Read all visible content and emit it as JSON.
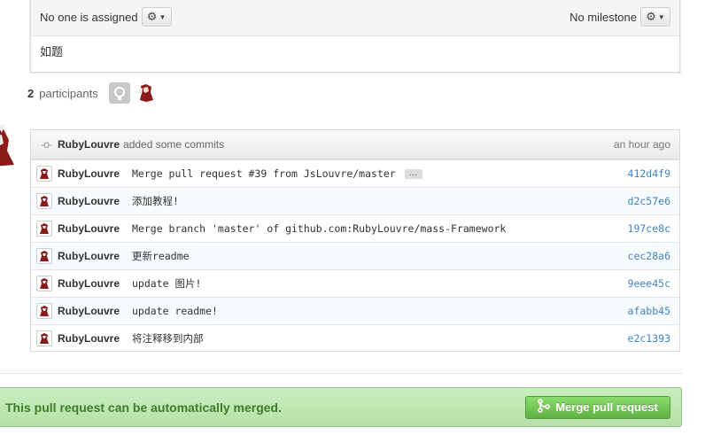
{
  "issue": {
    "assignee_text": "No one is assigned",
    "milestone_text": "No milestone",
    "body": "如题"
  },
  "participants": {
    "count": "2",
    "label": "participants"
  },
  "commits": {
    "author": "RubyLouvre",
    "action": "added some commits",
    "time": "an hour ago",
    "ellipsis": "…",
    "rows": [
      {
        "author": "RubyLouvre",
        "message": "Merge pull request #39 from JsLouvre/master",
        "sha": "412d4f9"
      },
      {
        "author": "RubyLouvre",
        "message": "添加教程!",
        "sha": "d2c57e6"
      },
      {
        "author": "RubyLouvre",
        "message": "Merge branch 'master' of github.com:RubyLouvre/mass-Framework",
        "sha": "197ce8c"
      },
      {
        "author": "RubyLouvre",
        "message": "更新readme",
        "sha": "cec28a6"
      },
      {
        "author": "RubyLouvre",
        "message": "update 图片!",
        "sha": "9eee45c"
      },
      {
        "author": "RubyLouvre",
        "message": "update readme!",
        "sha": "afabb45"
      },
      {
        "author": "RubyLouvre",
        "message": "将注释移到内部",
        "sha": "e2c1393"
      }
    ]
  },
  "merge": {
    "status_text": "This pull request can be automatically merged.",
    "button_label": "Merge pull request"
  },
  "colors": {
    "link": "#4183c4",
    "merge_green": "#3c7d2a",
    "button_green": "#60b044"
  },
  "icons": [
    "gear-icon",
    "caret-down-icon",
    "commit-icon",
    "merge-icon",
    "github-avatar-icon",
    "user-avatar-icon"
  ]
}
